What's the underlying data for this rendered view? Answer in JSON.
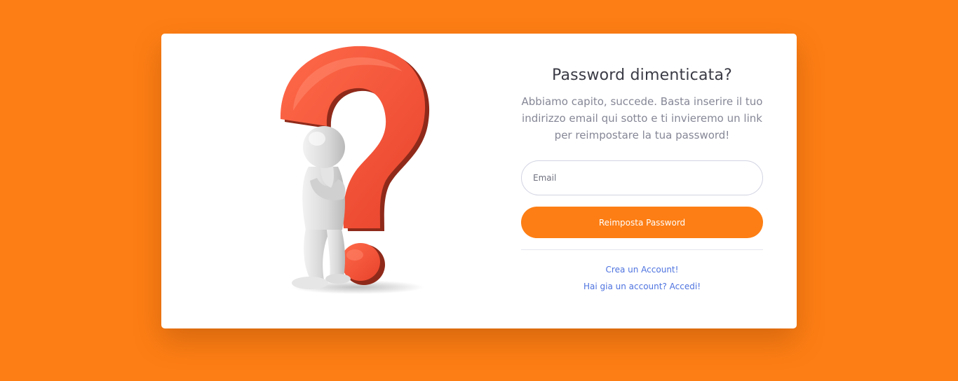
{
  "form": {
    "title": "Password dimenticata?",
    "subtitle": "Abbiamo capito, succede. Basta inserire il tuo indirizzo email qui sotto e ti invieremo un link per reimpostare la tua password!",
    "email_placeholder": "Email",
    "email_value": "",
    "submit_label": "Reimposta Password"
  },
  "links": {
    "create_account": "Crea un Account!",
    "login": "Hai gia un account? Accedi!"
  },
  "illustration": {
    "icon": "question-mark-thinking-person-icon"
  },
  "colors": {
    "background": "#fd7e14",
    "button": "#fd7e14",
    "question_mark": "#f4533a",
    "link": "#4e73df"
  }
}
